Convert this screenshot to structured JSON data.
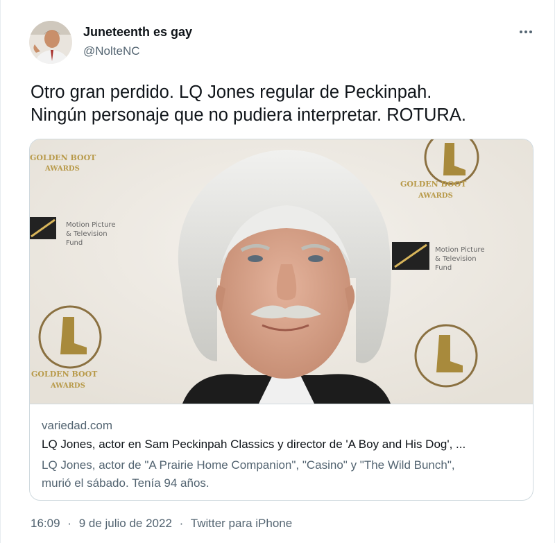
{
  "author": {
    "display_name": "Juneteenth es gay",
    "handle": "@NolteNC",
    "avatar_icon": "user-avatar"
  },
  "more_icon": "more-options-icon",
  "tweet": {
    "line1": "Otro gran perdido. LQ Jones regular de Peckinpah.",
    "line2": "Ningún personaje que no pudiera interpretar. ROTURA."
  },
  "card": {
    "domain": "variedad.com",
    "title": "LQ Jones, actor en Sam Peckinpah Classics y director de 'A Boy and His Dog', ...",
    "description_line1": "LQ Jones, actor de \"A Prairie Home Companion\", \"Casino\" y \"The Wild Bunch\",",
    "description_line2": "murió el sábado. Tenía 94 años.",
    "backdrop_text": {
      "golden_boot": "GOLDEN BOOT",
      "awards": "AWARDS",
      "mptf_line1": "Motion Picture",
      "mptf_line2": "& Television",
      "mptf_line3": "Fund"
    }
  },
  "footer": {
    "time": "16:09",
    "separator1": "·",
    "date": "9 de julio de 2022",
    "separator2": "·",
    "source": "Twitter para iPhone"
  },
  "colors": {
    "text": "#0f1419",
    "secondary": "#536471",
    "border": "#cfd9de"
  }
}
